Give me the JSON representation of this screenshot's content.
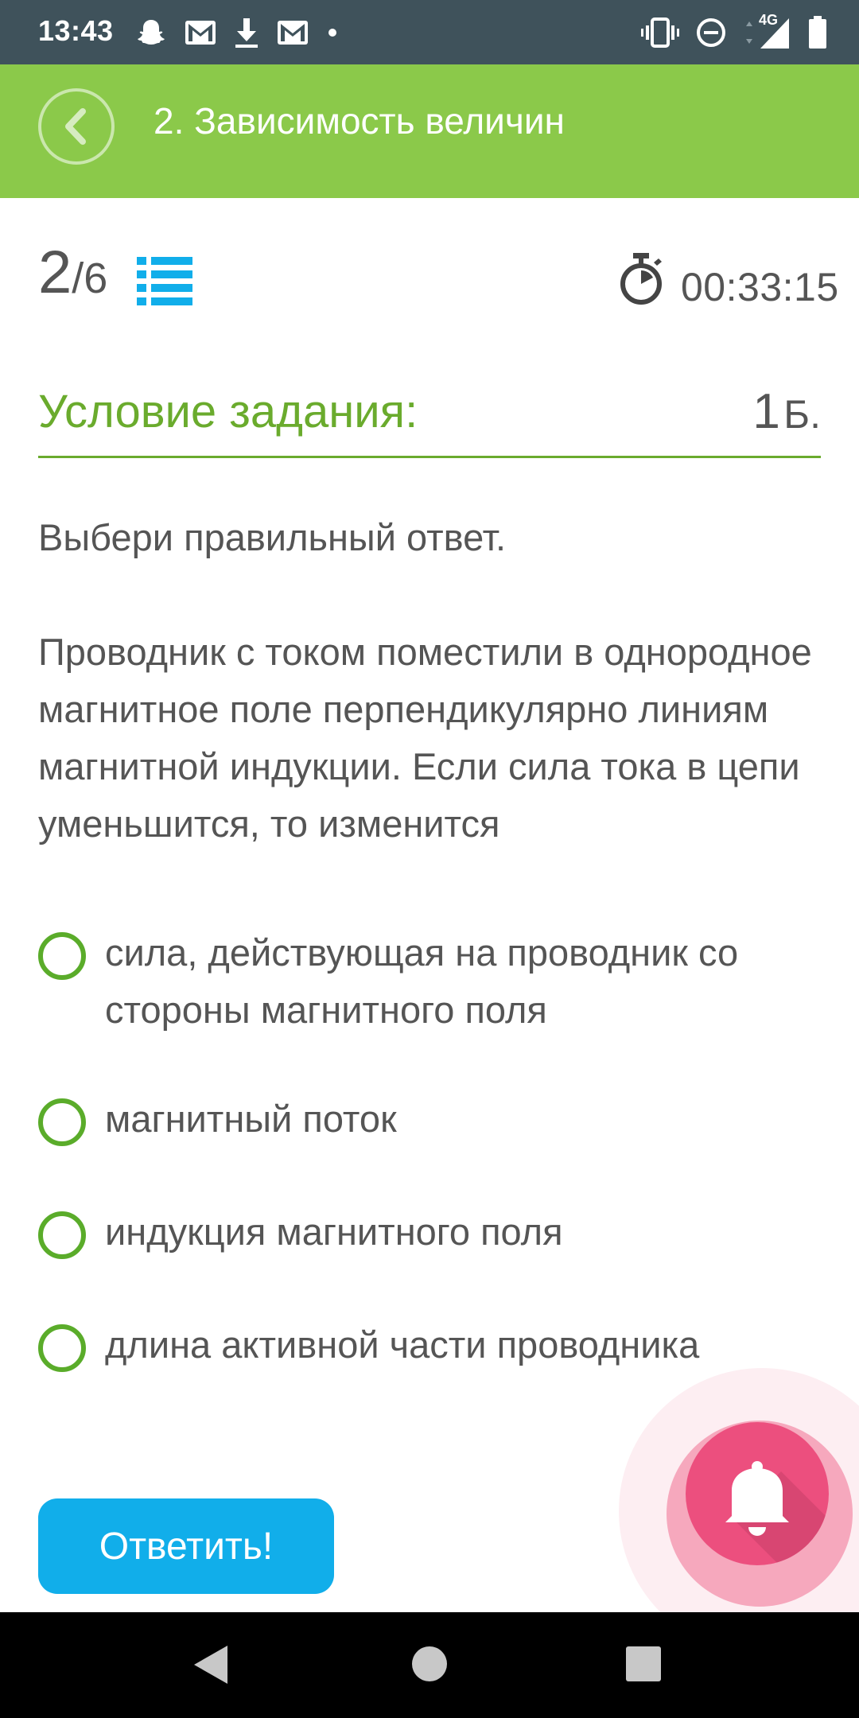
{
  "status_bar": {
    "time": "13:43",
    "network": "4G",
    "left_icons": [
      "snapchat-icon",
      "gmail-icon",
      "download-icon",
      "gmail-icon",
      "dot-icon"
    ],
    "right_icons": [
      "vibrate-icon",
      "do-not-disturb-icon",
      "signal-icon",
      "battery-icon"
    ]
  },
  "app_bar": {
    "title": "2. Зависимость величин",
    "color": "#8bc94a"
  },
  "progress": {
    "current": "2",
    "separator": "/",
    "total": "6"
  },
  "timer": {
    "value": "00:33:15"
  },
  "condition": {
    "label": "Условие задания:",
    "points_value": "1",
    "points_unit": "Б."
  },
  "question": {
    "instruction": "Выбери правильный ответ.",
    "text": "Проводник с током поместили в однородное магнитное поле перпендикулярно линиям магнитной индукции. Если сила тока в цепи уменьшится, то изменится"
  },
  "options": [
    {
      "label": "сила, действующая на проводник со стороны магнитного поля"
    },
    {
      "label": "магнитный поток"
    },
    {
      "label": "индукция магнитного поля"
    },
    {
      "label": "длина активной части проводника"
    }
  ],
  "submit": {
    "label": "Ответить!",
    "color": "#11aeea"
  },
  "colors": {
    "accent_green": "#6aab2d",
    "fab_pink": "#ec4f7e",
    "list_icon_blue": "#11aeea"
  }
}
